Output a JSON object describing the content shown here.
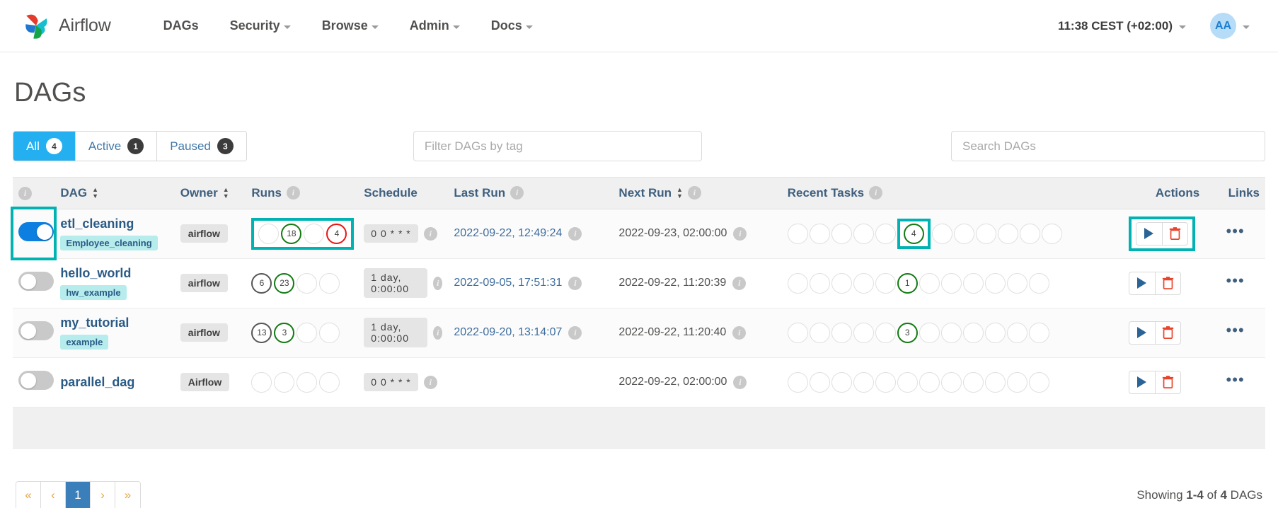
{
  "navbar": {
    "brand": "Airflow",
    "brand_icon": "airflow-pinwheel-logo",
    "links": [
      {
        "label": "DAGs",
        "has_caret": false
      },
      {
        "label": "Security",
        "has_caret": true
      },
      {
        "label": "Browse",
        "has_caret": true
      },
      {
        "label": "Admin",
        "has_caret": true
      },
      {
        "label": "Docs",
        "has_caret": true
      }
    ],
    "clock": "11:38 CEST (+02:00)",
    "avatar_initials": "AA"
  },
  "page": {
    "title": "DAGs"
  },
  "filters": {
    "tabs": [
      {
        "label": "All",
        "count": "4",
        "active": true
      },
      {
        "label": "Active",
        "count": "1",
        "active": false
      },
      {
        "label": "Paused",
        "count": "3",
        "active": false
      }
    ],
    "tag_placeholder": "Filter DAGs by tag",
    "tag_value": "",
    "search_placeholder": "Search DAGs",
    "search_value": ""
  },
  "table": {
    "headers": {
      "info": "i",
      "dag": "DAG",
      "owner": "Owner",
      "runs": "Runs",
      "schedule": "Schedule",
      "last_run": "Last Run",
      "next_run": "Next Run",
      "recent_tasks": "Recent Tasks",
      "actions": "Actions",
      "links": "Links"
    },
    "rows": [
      {
        "name": "etl_cleaning",
        "tag": "Employee_cleaning",
        "toggle_on": true,
        "owner": "airflow",
        "runs": [
          {
            "value": "",
            "state": "empty"
          },
          {
            "value": "18",
            "state": "green"
          },
          {
            "value": "",
            "state": "empty"
          },
          {
            "value": "4",
            "state": "red"
          }
        ],
        "schedule": "0 0 * * *",
        "last_run": "2022-09-22, 12:49:24",
        "next_run": "2022-09-23, 02:00:00",
        "recent_tasks": [
          "",
          "",
          "",
          "",
          "",
          "4",
          "",
          "",
          "",
          "",
          "",
          ""
        ],
        "recent_tasks_states": [
          "empty",
          "empty",
          "empty",
          "empty",
          "empty",
          "green",
          "empty",
          "empty",
          "empty",
          "empty",
          "empty",
          "empty"
        ],
        "highlight_toggle": true,
        "highlight_runs": true,
        "highlight_recent_task_index": 5,
        "highlight_actions": true
      },
      {
        "name": "hello_world",
        "tag": "hw_example",
        "toggle_on": false,
        "owner": "airflow",
        "runs": [
          {
            "value": "6",
            "state": "dark"
          },
          {
            "value": "23",
            "state": "green"
          },
          {
            "value": "",
            "state": "empty"
          },
          {
            "value": "",
            "state": "empty"
          }
        ],
        "schedule": "1 day, 0:00:00",
        "last_run": "2022-09-05, 17:51:31",
        "next_run": "2022-09-22, 11:20:39",
        "recent_tasks": [
          "",
          "",
          "",
          "",
          "",
          "1",
          "",
          "",
          "",
          "",
          "",
          ""
        ],
        "recent_tasks_states": [
          "empty",
          "empty",
          "empty",
          "empty",
          "empty",
          "green",
          "empty",
          "empty",
          "empty",
          "empty",
          "empty",
          "empty"
        ],
        "highlight_toggle": false,
        "highlight_runs": false,
        "highlight_recent_task_index": -1,
        "highlight_actions": false
      },
      {
        "name": "my_tutorial",
        "tag": "example",
        "toggle_on": false,
        "owner": "airflow",
        "runs": [
          {
            "value": "13",
            "state": "dark"
          },
          {
            "value": "3",
            "state": "green"
          },
          {
            "value": "",
            "state": "empty"
          },
          {
            "value": "",
            "state": "empty"
          }
        ],
        "schedule": "1 day, 0:00:00",
        "last_run": "2022-09-20, 13:14:07",
        "next_run": "2022-09-22, 11:20:40",
        "recent_tasks": [
          "",
          "",
          "",
          "",
          "",
          "3",
          "",
          "",
          "",
          "",
          "",
          ""
        ],
        "recent_tasks_states": [
          "empty",
          "empty",
          "empty",
          "empty",
          "empty",
          "green",
          "empty",
          "empty",
          "empty",
          "empty",
          "empty",
          "empty"
        ],
        "highlight_toggle": false,
        "highlight_runs": false,
        "highlight_recent_task_index": -1,
        "highlight_actions": false
      },
      {
        "name": "parallel_dag",
        "tag": "",
        "toggle_on": false,
        "owner": "Airflow",
        "runs": [
          {
            "value": "",
            "state": "empty"
          },
          {
            "value": "",
            "state": "empty"
          },
          {
            "value": "",
            "state": "empty"
          },
          {
            "value": "",
            "state": "empty"
          }
        ],
        "schedule": "0 0 * * *",
        "last_run": "",
        "next_run": "2022-09-22, 02:00:00",
        "recent_tasks": [
          "",
          "",
          "",
          "",
          "",
          "",
          "",
          "",
          "",
          "",
          "",
          ""
        ],
        "recent_tasks_states": [
          "empty",
          "empty",
          "empty",
          "empty",
          "empty",
          "empty",
          "empty",
          "empty",
          "empty",
          "empty",
          "empty",
          "empty"
        ],
        "highlight_toggle": false,
        "highlight_runs": false,
        "highlight_recent_task_index": -1,
        "highlight_actions": false
      }
    ]
  },
  "footer": {
    "pager": [
      "«",
      "‹",
      "1",
      "›",
      "»"
    ],
    "current_page": "1",
    "showing_prefix": "Showing ",
    "showing_range": "1-4",
    "showing_middle": " of ",
    "showing_total": "4",
    "showing_suffix": " DAGs"
  },
  "colors": {
    "accent": "#24b0f0",
    "highlight": "#00b2b2",
    "success": "#127a12",
    "danger": "#e81414",
    "link": "#2a5a86"
  }
}
